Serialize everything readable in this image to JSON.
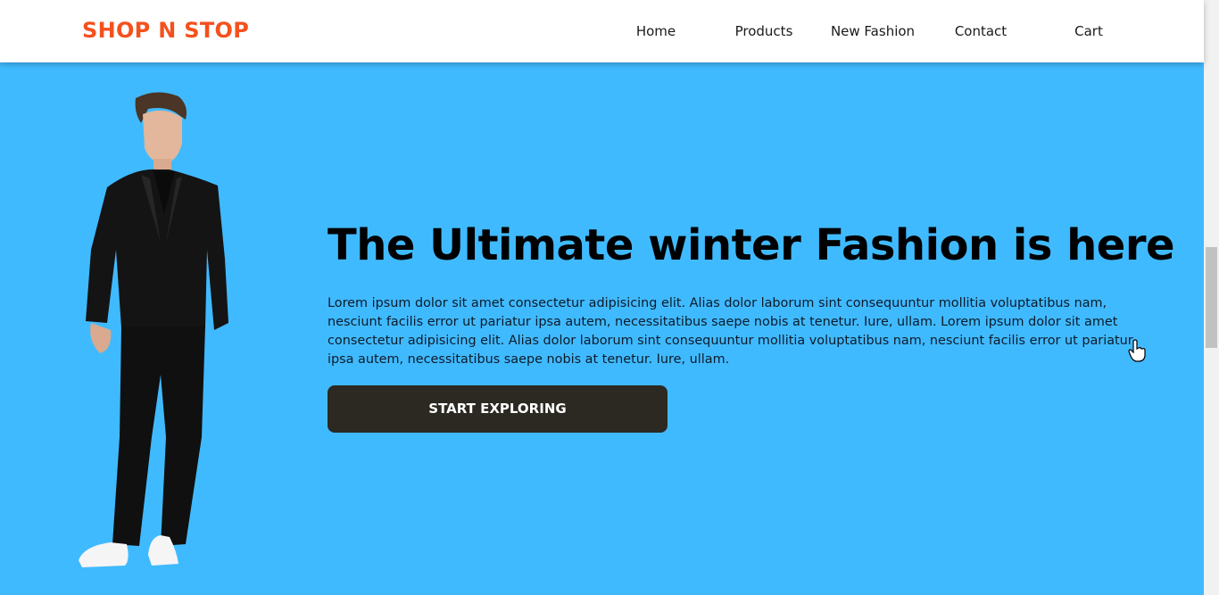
{
  "brand": {
    "logo": "SHOP N STOP",
    "accent": "#f4511e"
  },
  "nav": {
    "items": [
      {
        "label": "Home"
      },
      {
        "label": "Products"
      },
      {
        "label": "New Fashion"
      },
      {
        "label": "Contact"
      },
      {
        "label": "Cart"
      }
    ]
  },
  "hero": {
    "title": "The Ultimate winter Fashion is here",
    "body": "Lorem ipsum dolor sit amet consectetur adipisicing elit. Alias dolor laborum sint consequuntur mollitia voluptatibus nam, nesciunt facilis error ut pariatur ipsa autem, necessitatibus saepe nobis at tenetur. Iure, ullam. Lorem ipsum dolor sit amet consectetur adipisicing elit. Alias dolor laborum sint consequuntur mollitia voluptatibus nam, nesciunt facilis error ut pariatur ipsa autem, necessitatibus saepe nobis at tenetur. Iure, ullam.",
    "cta_label": "START EXPLORING",
    "background": "#40baff",
    "cta_color": "#2b2922"
  },
  "icons": {
    "cursor": "hand-pointer-icon",
    "figure": "model-image"
  }
}
